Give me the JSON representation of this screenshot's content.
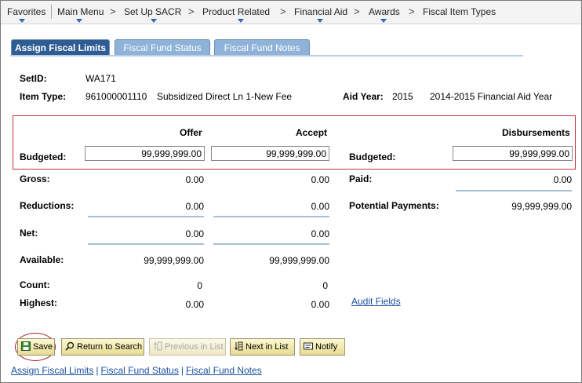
{
  "nav": {
    "favorites": "Favorites",
    "main_menu": "Main Menu",
    "setup_sacr": "Set Up SACR",
    "product_related": "Product Related",
    "financial_aid": "Financial Aid",
    "awards": "Awards",
    "fiscal_item_types": "Fiscal Item Types",
    "chevron": ">"
  },
  "tabs": [
    {
      "label": "Assign Fiscal Limits"
    },
    {
      "label": "Fiscal Fund Status"
    },
    {
      "label": "Fiscal Fund Notes"
    }
  ],
  "header": {
    "setid_label": "SetID:",
    "setid_value": "WA171",
    "item_type_label": "Item Type:",
    "item_type_code": "961000001110",
    "item_type_desc": "Subsidized Direct Ln 1-New Fee",
    "aid_year_label": "Aid Year:",
    "aid_year_value": "2015",
    "aid_year_desc": "2014-2015 Financial Aid Year"
  },
  "columns": {
    "offer": "Offer",
    "accept": "Accept",
    "disbursements": "Disbursements"
  },
  "rows": {
    "budgeted_label": "Budgeted:",
    "budgeted_offer": "99,999,999.00",
    "budgeted_accept": "99,999,999.00",
    "budgeted_disb": "99,999,999.00",
    "gross_label": "Gross:",
    "gross_offer": "0.00",
    "gross_accept": "0.00",
    "paid_label": "Paid:",
    "paid_value": "0.00",
    "reductions_label": "Reductions:",
    "reductions_offer": "0.00",
    "reductions_accept": "0.00",
    "potential_label": "Potential Payments:",
    "potential_value": "99,999,999.00",
    "net_label": "Net:",
    "net_offer": "0.00",
    "net_accept": "0.00",
    "available_label": "Available:",
    "available_offer": "99,999,999.00",
    "available_accept": "99,999,999.00",
    "count_label": "Count:",
    "count_offer": "0",
    "count_accept": "0",
    "highest_label": "Highest:",
    "highest_offer": "0.00",
    "highest_accept": "0.00"
  },
  "links": {
    "audit_fields": "Audit Fields"
  },
  "toolbar": {
    "save": "Save",
    "return_to_search": "Return to Search",
    "previous_in_list": "Previous in List",
    "next_in_list": "Next in List",
    "notify": "Notify"
  },
  "footer_links": [
    "Assign Fiscal Limits",
    "Fiscal Fund Status",
    "Fiscal Fund Notes"
  ],
  "colors": {
    "active_tab": "#2e5c93",
    "inactive_tab": "#8fb2d8",
    "highlight_border": "#c0343c",
    "link": "#1a4f9c"
  }
}
